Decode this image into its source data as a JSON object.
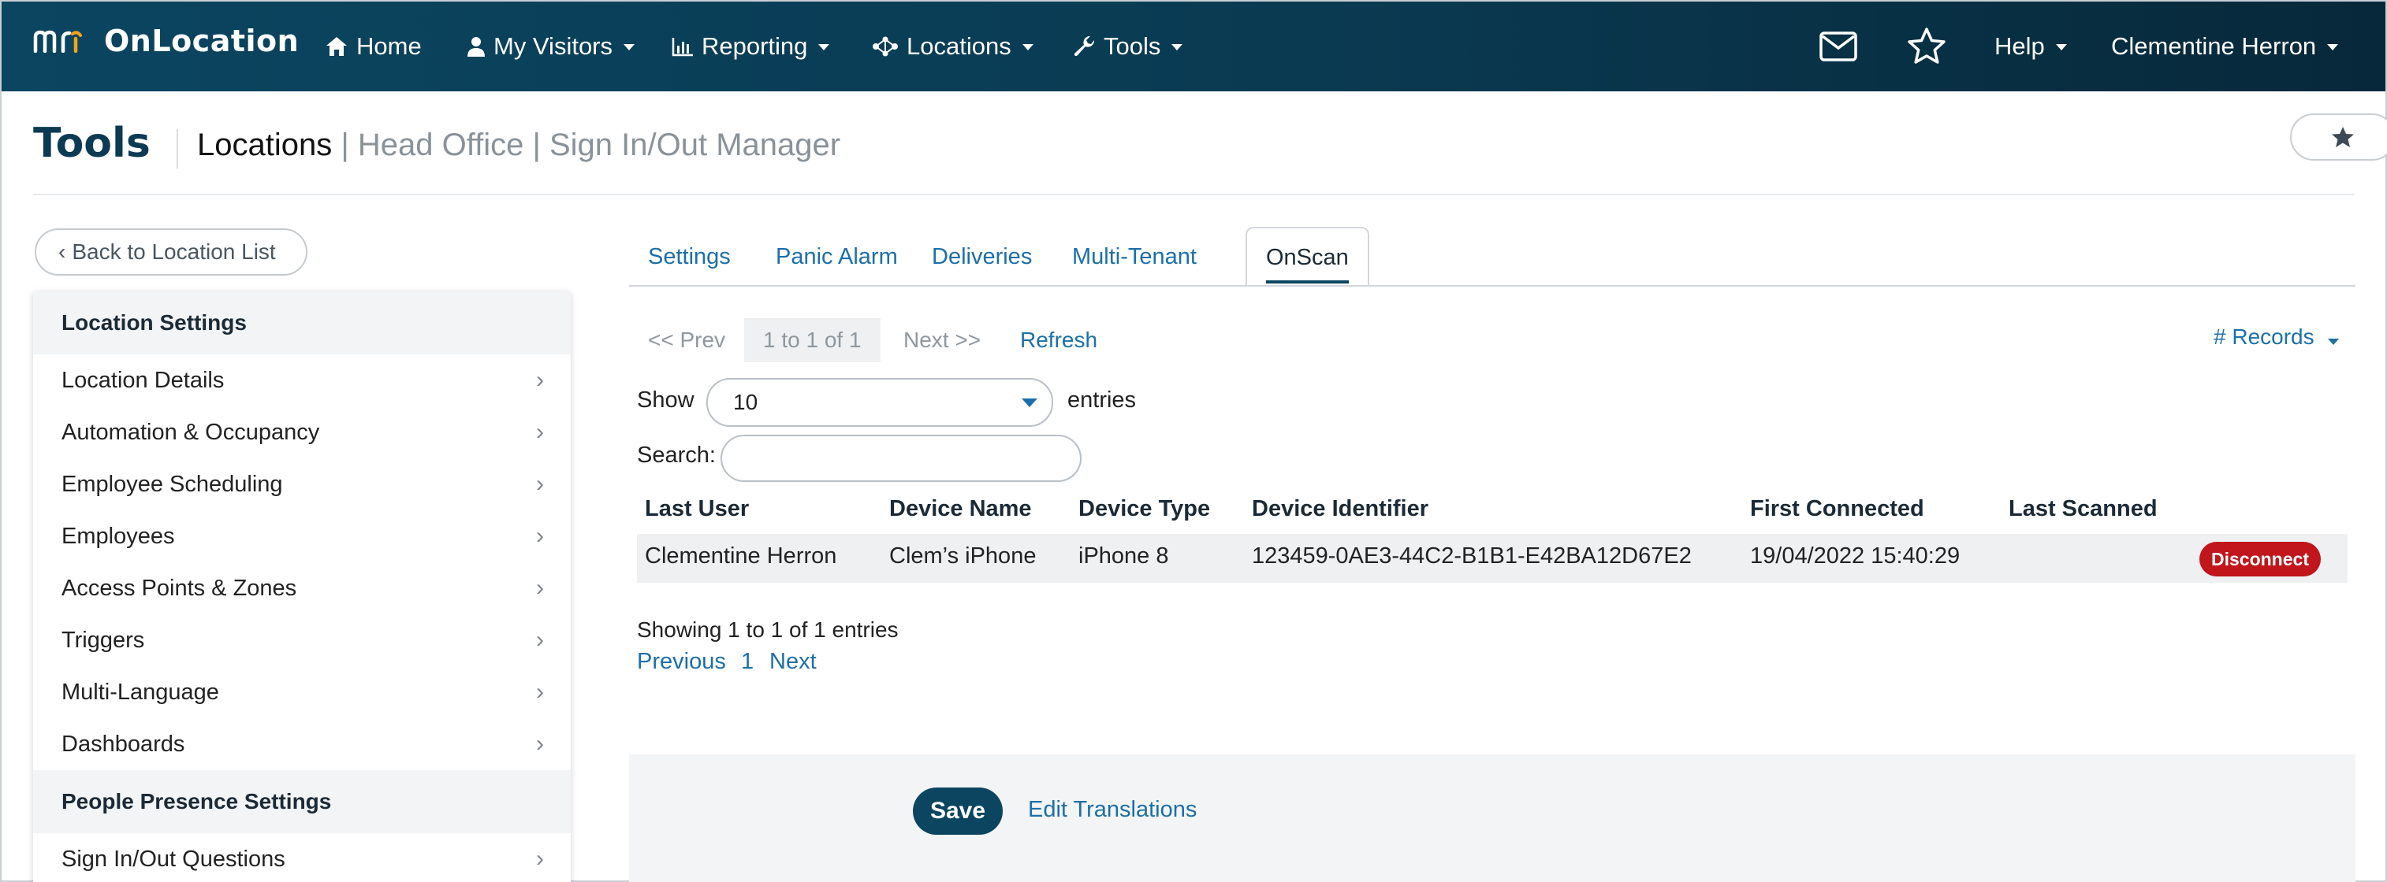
{
  "brand": {
    "name": "OnLocation",
    "logo_text": "mri"
  },
  "nav": {
    "home": "Home",
    "visitors": "My Visitors",
    "reporting": "Reporting",
    "locations": "Locations",
    "tools": "Tools",
    "help": "Help",
    "user": "Clementine Herron"
  },
  "page": {
    "title": "Tools",
    "crumb_main": "Locations",
    "crumb_sub": " | Head Office | Sign In/Out Manager"
  },
  "sidebar": {
    "back": "Back to Location List",
    "sections": [
      {
        "header": "Location Settings",
        "items": [
          {
            "label": "Location Details"
          },
          {
            "label": "Automation & Occupancy"
          },
          {
            "label": "Employee Scheduling"
          },
          {
            "label": "Employees"
          },
          {
            "label": "Access Points & Zones"
          },
          {
            "label": "Triggers"
          },
          {
            "label": "Multi-Language"
          },
          {
            "label": "Dashboards"
          }
        ]
      },
      {
        "header": "People Presence Settings",
        "items": [
          {
            "label": "Sign In/Out Questions"
          }
        ]
      }
    ]
  },
  "tabs": [
    {
      "label": "Settings",
      "active": false
    },
    {
      "label": "Panic Alarm",
      "active": false
    },
    {
      "label": "Deliveries",
      "active": false
    },
    {
      "label": "Multi-Tenant",
      "active": false
    },
    {
      "label": "OnScan",
      "active": true
    }
  ],
  "pager": {
    "prev": "<< Prev",
    "count": "1 to 1 of 1",
    "next": "Next >>",
    "refresh": "Refresh",
    "records": "# Records"
  },
  "filters": {
    "show_label": "Show",
    "show_value": "10",
    "entries_label": "entries",
    "search_label": "Search:",
    "search_value": ""
  },
  "table": {
    "columns": [
      "Last User",
      "Device Name",
      "Device Type",
      "Device Identifier",
      "First Connected",
      "Last Scanned"
    ],
    "rows": [
      {
        "last_user": "Clementine Herron",
        "device_name": "Clem’s iPhone",
        "device_type": "iPhone 8",
        "device_identifier": "123459-0AE3-44C2-B1B1-E42BA12D67E2",
        "first_connected": "19/04/2022 15:40:29",
        "last_scanned": "",
        "action": "Disconnect"
      }
    ],
    "info": "Showing 1 to 1 of 1 entries",
    "pagination": {
      "previous": "Previous",
      "page": "1",
      "next": "Next"
    }
  },
  "footer": {
    "save": "Save",
    "edit_translations": "Edit Translations"
  },
  "colors": {
    "nav_bg": "#0b4560",
    "link": "#1c6fa8",
    "danger": "#c0161c",
    "logo_accent": "#f4a11e"
  }
}
